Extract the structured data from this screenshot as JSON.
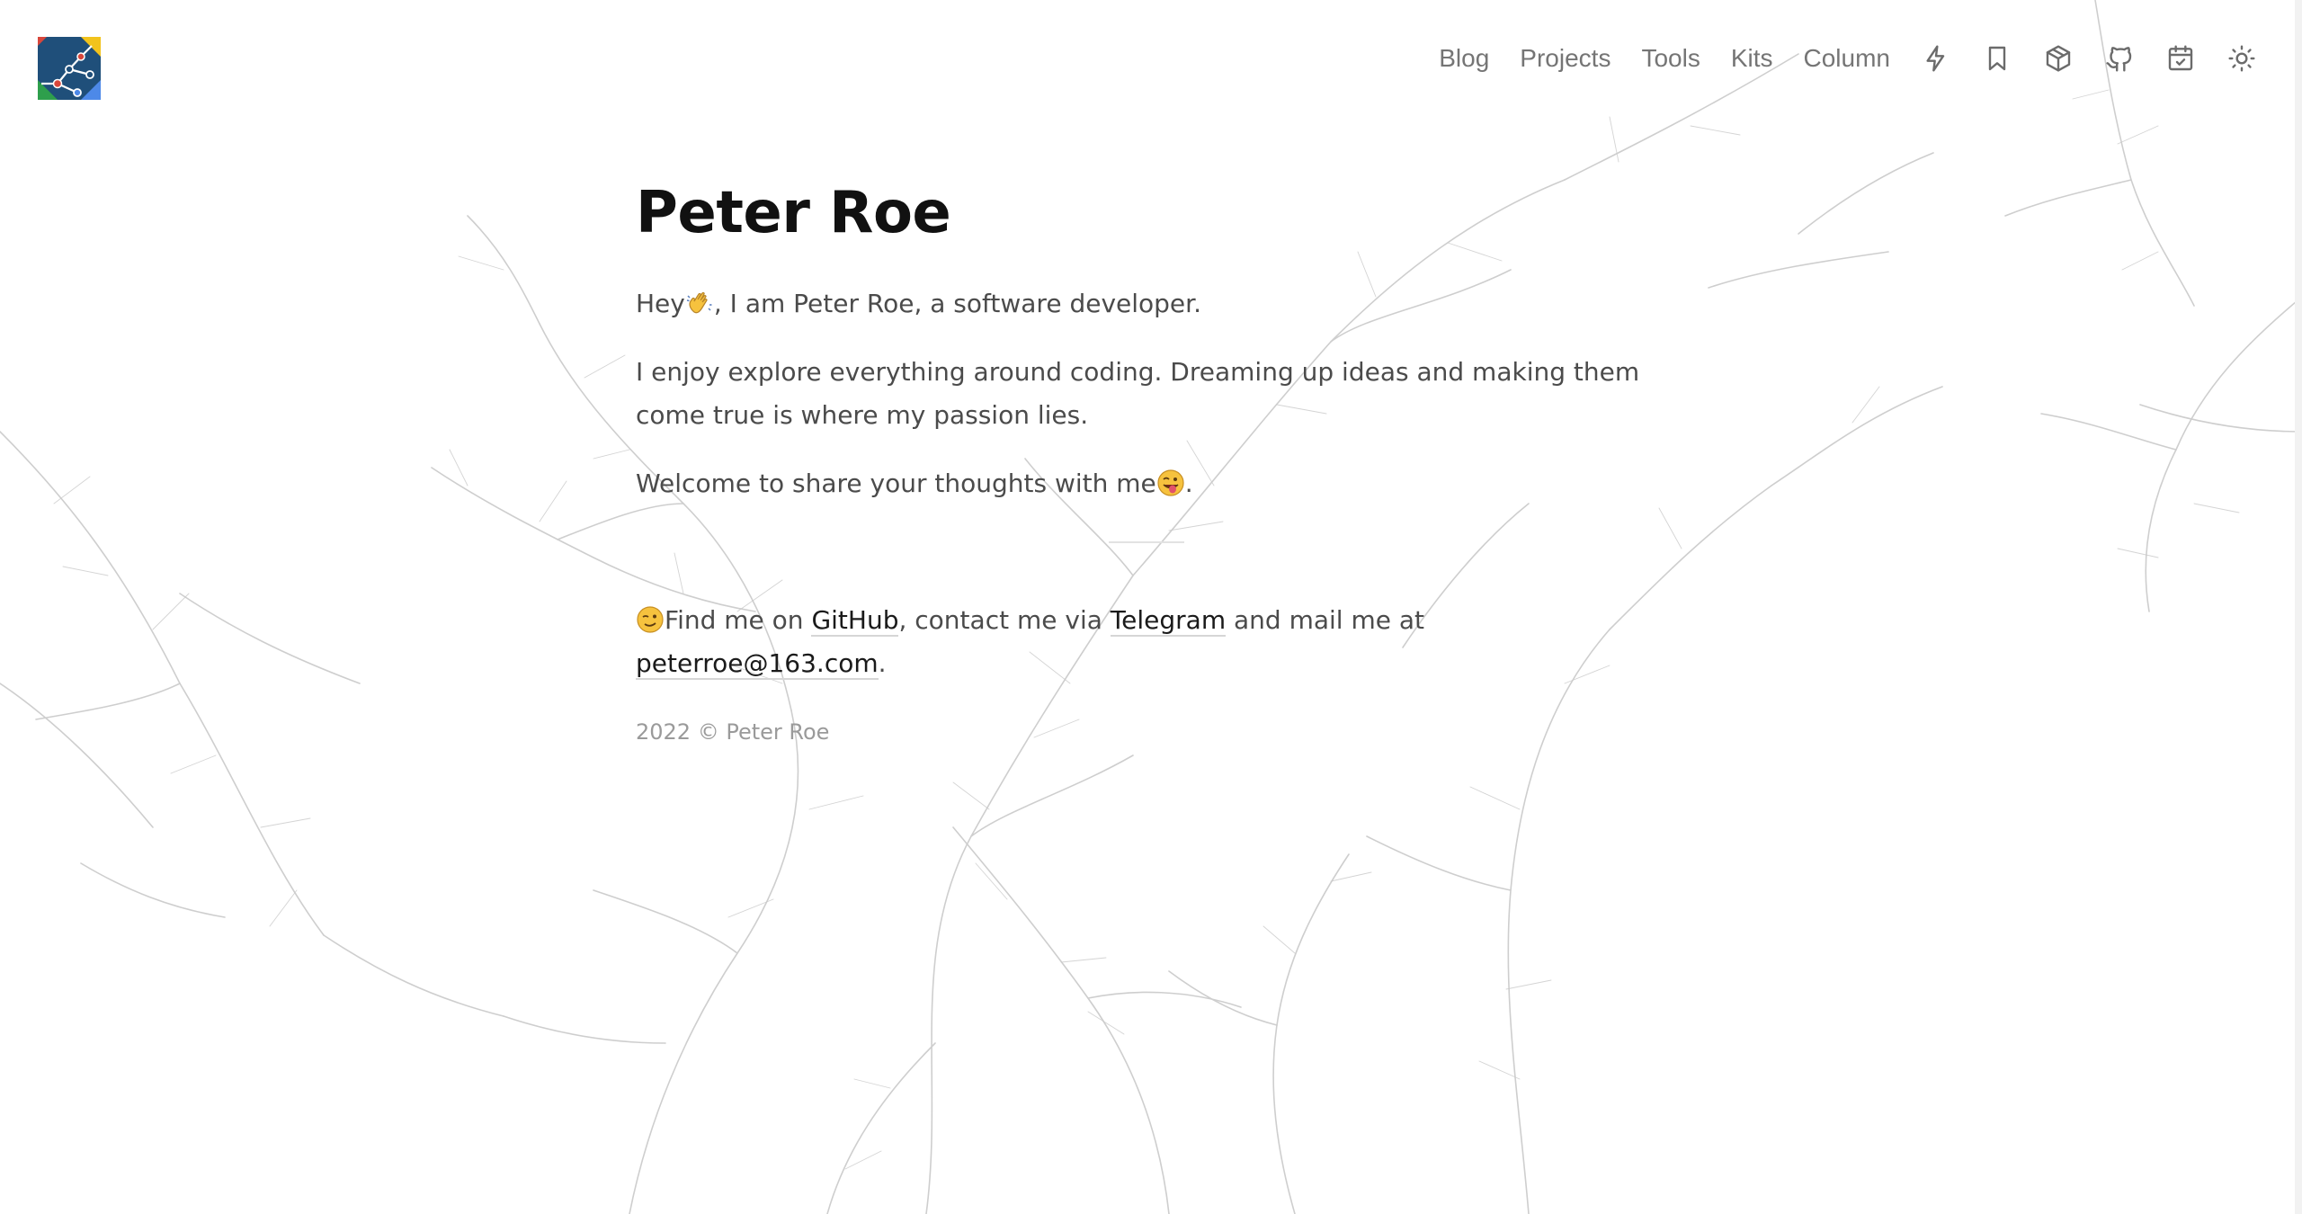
{
  "nav": {
    "links": [
      "Blog",
      "Projects",
      "Tools",
      "Kits",
      "Column"
    ],
    "icons": [
      "lightning-icon",
      "bookmark-icon",
      "box-icon",
      "github-icon",
      "calendar-icon",
      "sun-icon"
    ]
  },
  "main": {
    "title": "Peter Roe",
    "intro_pre": "Hey",
    "intro_post": ", I am Peter Roe, a software developer.",
    "passion": "I enjoy explore everything around coding. Dreaming up ideas and making them come true is where my passion lies.",
    "welcome_pre": "Welcome to share your thoughts with me",
    "welcome_post": "."
  },
  "contact": {
    "find": "Find me on",
    "github": "GitHub",
    "via": ", contact me via",
    "telegram": "Telegram",
    "mail": "and mail me at",
    "email": "peterroe@163.com",
    "end": "."
  },
  "footer": {
    "text": "2022 © Peter Roe"
  },
  "colors": {
    "heading": "#111111",
    "body": "#4b4b4b",
    "nav": "#757575",
    "muted": "#9a9a9a",
    "logo_blue": "#1f4f7a",
    "logo_red": "#d8463b",
    "logo_yellow": "#f2c31c",
    "logo_green": "#2e9f4c",
    "logo_lightblue": "#4d89e8"
  }
}
